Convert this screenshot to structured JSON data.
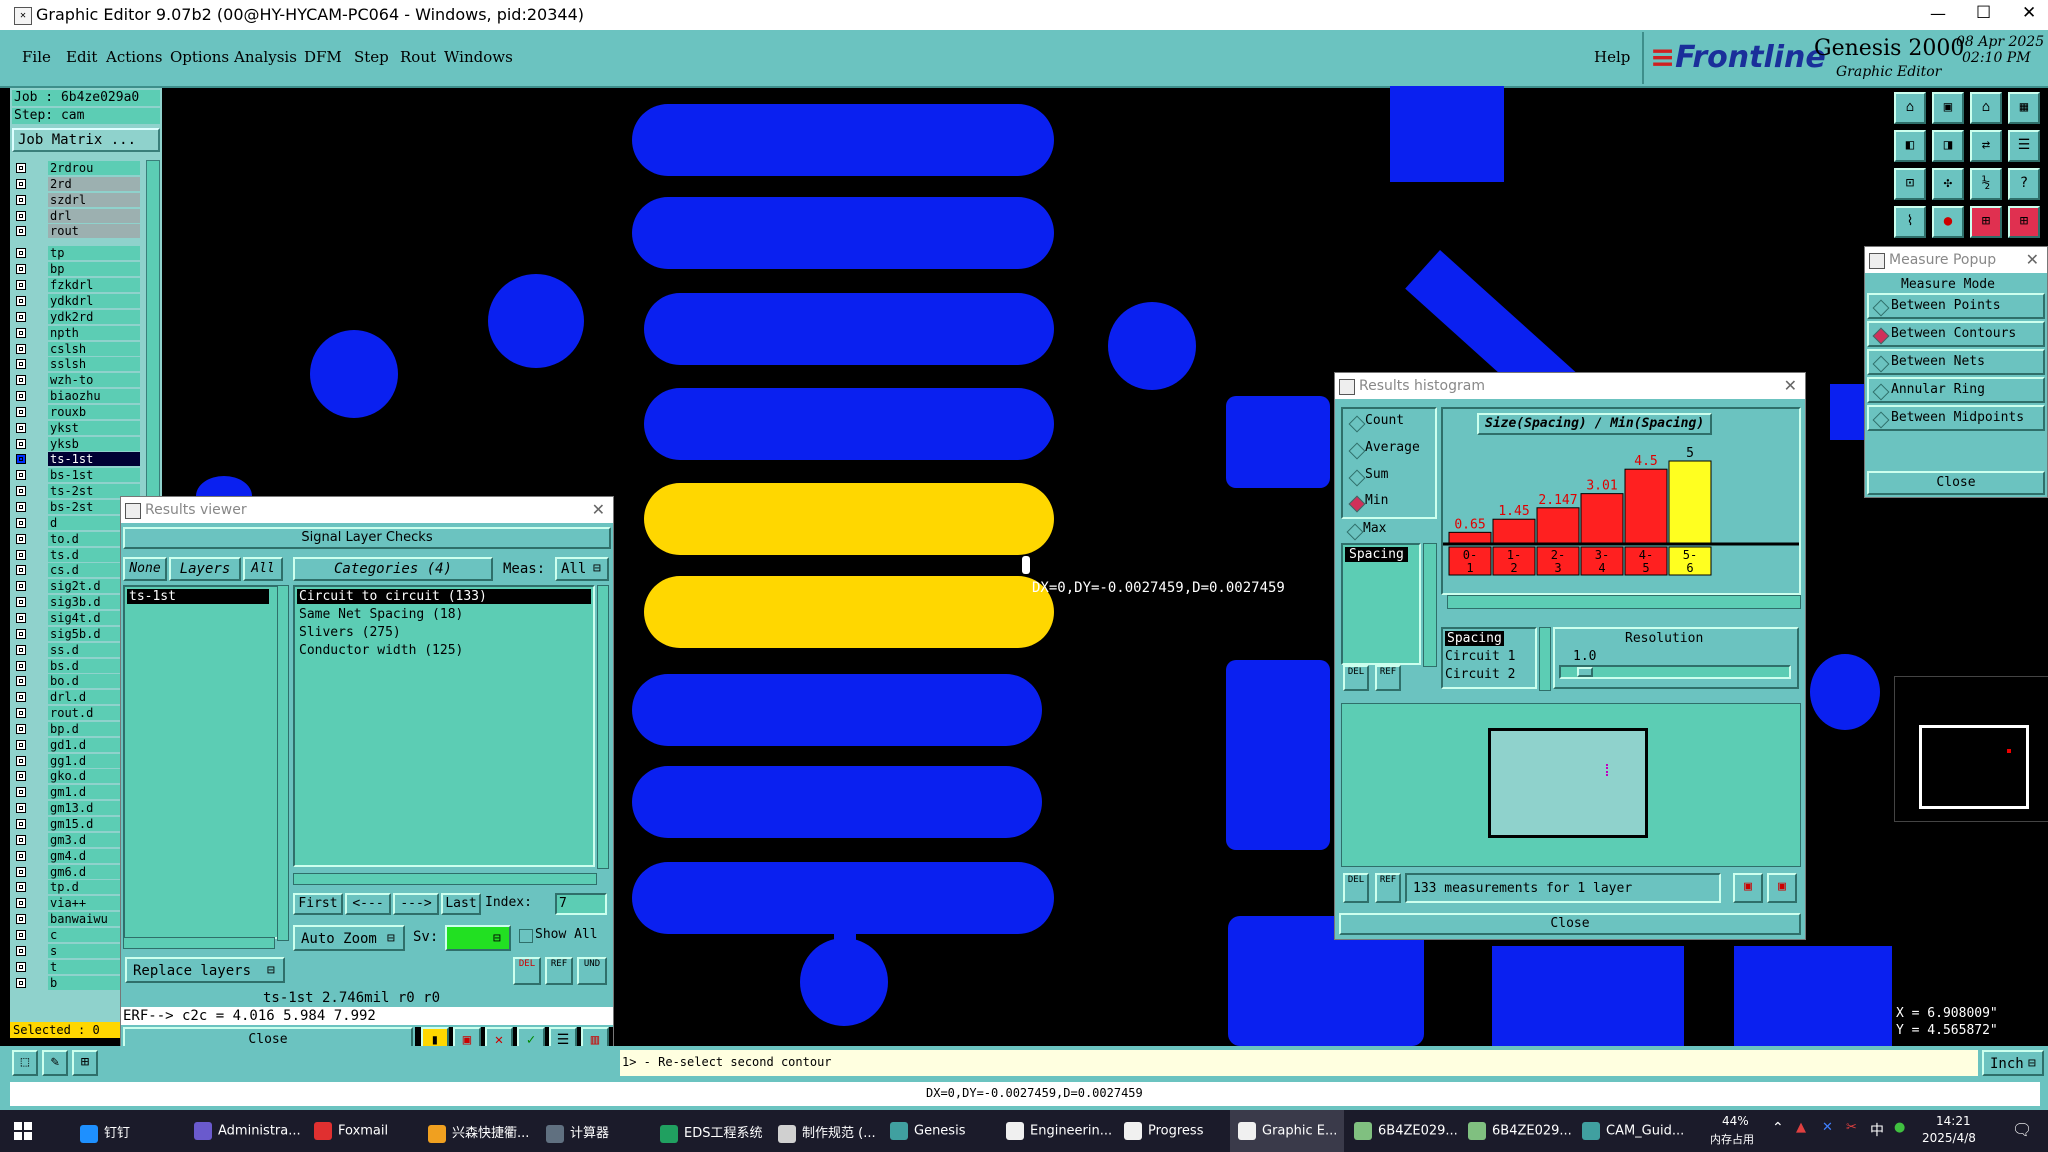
{
  "window": {
    "title": "Graphic Editor 9.07b2 (00@HY-HYCAM-PC064 - Windows, pid:20344)",
    "controls": [
      "—",
      "☐",
      "✕"
    ]
  },
  "menu": {
    "items": [
      "File",
      "Edit",
      "Actions",
      "Options",
      "Analysis",
      "DFM",
      "Step",
      "Rout",
      "Windows"
    ],
    "help": "Help"
  },
  "brand": {
    "logo": "Frontline",
    "product": "Genesis 2000",
    "subtitle": "Graphic Editor",
    "date": "08 Apr 2025",
    "time": "02:10 PM"
  },
  "left_panel": {
    "job": "Job : 6b4ze029a0",
    "step": "Step: cam",
    "job_matrix": "Job Matrix ...",
    "layers": [
      "2rdrou",
      "2rd",
      "szdrl",
      "drl",
      "rout",
      "tp",
      "bp",
      "fzkdrl",
      "ydkdrl",
      "ydk2rd",
      "npth",
      "cslsh",
      "sslsh",
      "wzh-to",
      "biaozhu",
      "rouxb",
      "ykst",
      "yksb",
      "ts-1st",
      "bs-1st",
      "ts-2st",
      "bs-2st",
      "d",
      "to.d",
      "ts.d",
      "cs.d",
      "sig2t.d",
      "sig3b.d",
      "sig4t.d",
      "sig5b.d",
      "ss.d",
      "bs.d",
      "bo.d",
      "drl.d",
      "rout.d",
      "bp.d",
      "gd1.d",
      "gg1.d",
      "gko.d",
      "gm1.d",
      "gm13.d",
      "gm15.d",
      "gm3.d",
      "gm4.d",
      "gm6.d",
      "tp.d",
      "via++",
      "banwaiwu",
      "c",
      "s",
      "t",
      "b"
    ],
    "selected": "Selected : 0"
  },
  "canvas": {
    "measure_label": "DX=0,DY=-0.0027459,D=0.0027459"
  },
  "results_viewer": {
    "title": "Results viewer",
    "header": "Signal Layer Checks",
    "none_btn": "None",
    "layers_btn": "Layers",
    "all_btn": "All",
    "categories": "Categories (4)",
    "meas_label": "Meas:",
    "meas_value": "All",
    "layer_list": [
      "ts-1st"
    ],
    "category_list": [
      "Circuit to circuit (133)",
      "Same Net Spacing (18)",
      "Slivers (275)",
      "Conductor width (125)"
    ],
    "first": "First",
    "prev": "<---",
    "next": "--->",
    "last": "Last",
    "index_label": "Index:",
    "index_value": "7",
    "auto_zoom": "Auto Zoom",
    "sv_label": "Sv:",
    "show_all": "Show All",
    "replace_layers": "Replace layers",
    "status": "ts-1st 2.746mil  r0  r0",
    "erf": "ERF--> c2c = 4.016 5.984 7.992",
    "close": "Close"
  },
  "histogram": {
    "title": "Results histogram",
    "options": [
      {
        "label": "Count",
        "on": false
      },
      {
        "label": "Average",
        "on": false
      },
      {
        "label": "Sum",
        "on": false
      },
      {
        "label": "Min",
        "on": true
      },
      {
        "label": "Max",
        "on": false
      }
    ],
    "chart_title": "Size(Spacing) / Min(Spacing)",
    "list_item": "Spacing",
    "chart_data": {
      "type": "bar",
      "categories": [
        "0-1",
        "1-2",
        "2-3",
        "3-4",
        "4-5",
        "5-6"
      ],
      "values": [
        0.65,
        1.45,
        2.147,
        3.01,
        4.5,
        5
      ],
      "value_labels": [
        "0.65",
        "1.45",
        "2.147",
        "3.01",
        "4.5",
        "5"
      ],
      "highlight_index": 5,
      "colors": {
        "bar": "#ff2020",
        "highlight": "#ffff20",
        "label": "#e00000"
      }
    },
    "sub_list": [
      "Spacing",
      "Circuit 1",
      "Circuit 2"
    ],
    "resolution_label": "Resolution",
    "resolution_value": "1.0",
    "measurements": "133 measurements for 1 layer",
    "close": "Close"
  },
  "measure_popup": {
    "title": "Measure Popup",
    "mode_label": "Measure Mode",
    "modes": [
      {
        "label": "Between Points",
        "on": false
      },
      {
        "label": "Between Contours",
        "on": true
      },
      {
        "label": "Between Nets",
        "on": false
      },
      {
        "label": "Annular Ring",
        "on": false
      },
      {
        "label": "Between Midpoints",
        "on": false
      }
    ],
    "close": "Close"
  },
  "coords": {
    "x": "X = 6.908009\"",
    "y": "Y = 4.565872\"",
    "units": "Inch"
  },
  "bottom": {
    "prompt": "1> - Re-select second contour",
    "status": "DX=0,DY=-0.0027459,D=0.0027459"
  },
  "taskbar": {
    "items": [
      "钉钉",
      "Administra...",
      "Foxmail",
      "兴森快捷衢...",
      "计算器",
      "EDS工程系统",
      "制作规范 (...",
      "Genesis",
      "Engineerin...",
      "Progress",
      "Graphic E...",
      "6B4ZE029...",
      "6B4ZE029...",
      "CAM_Guid..."
    ],
    "mem_pct": "44%",
    "mem_label": "内存占用",
    "lang": "中",
    "time": "14:21",
    "date": "2025/4/8"
  }
}
